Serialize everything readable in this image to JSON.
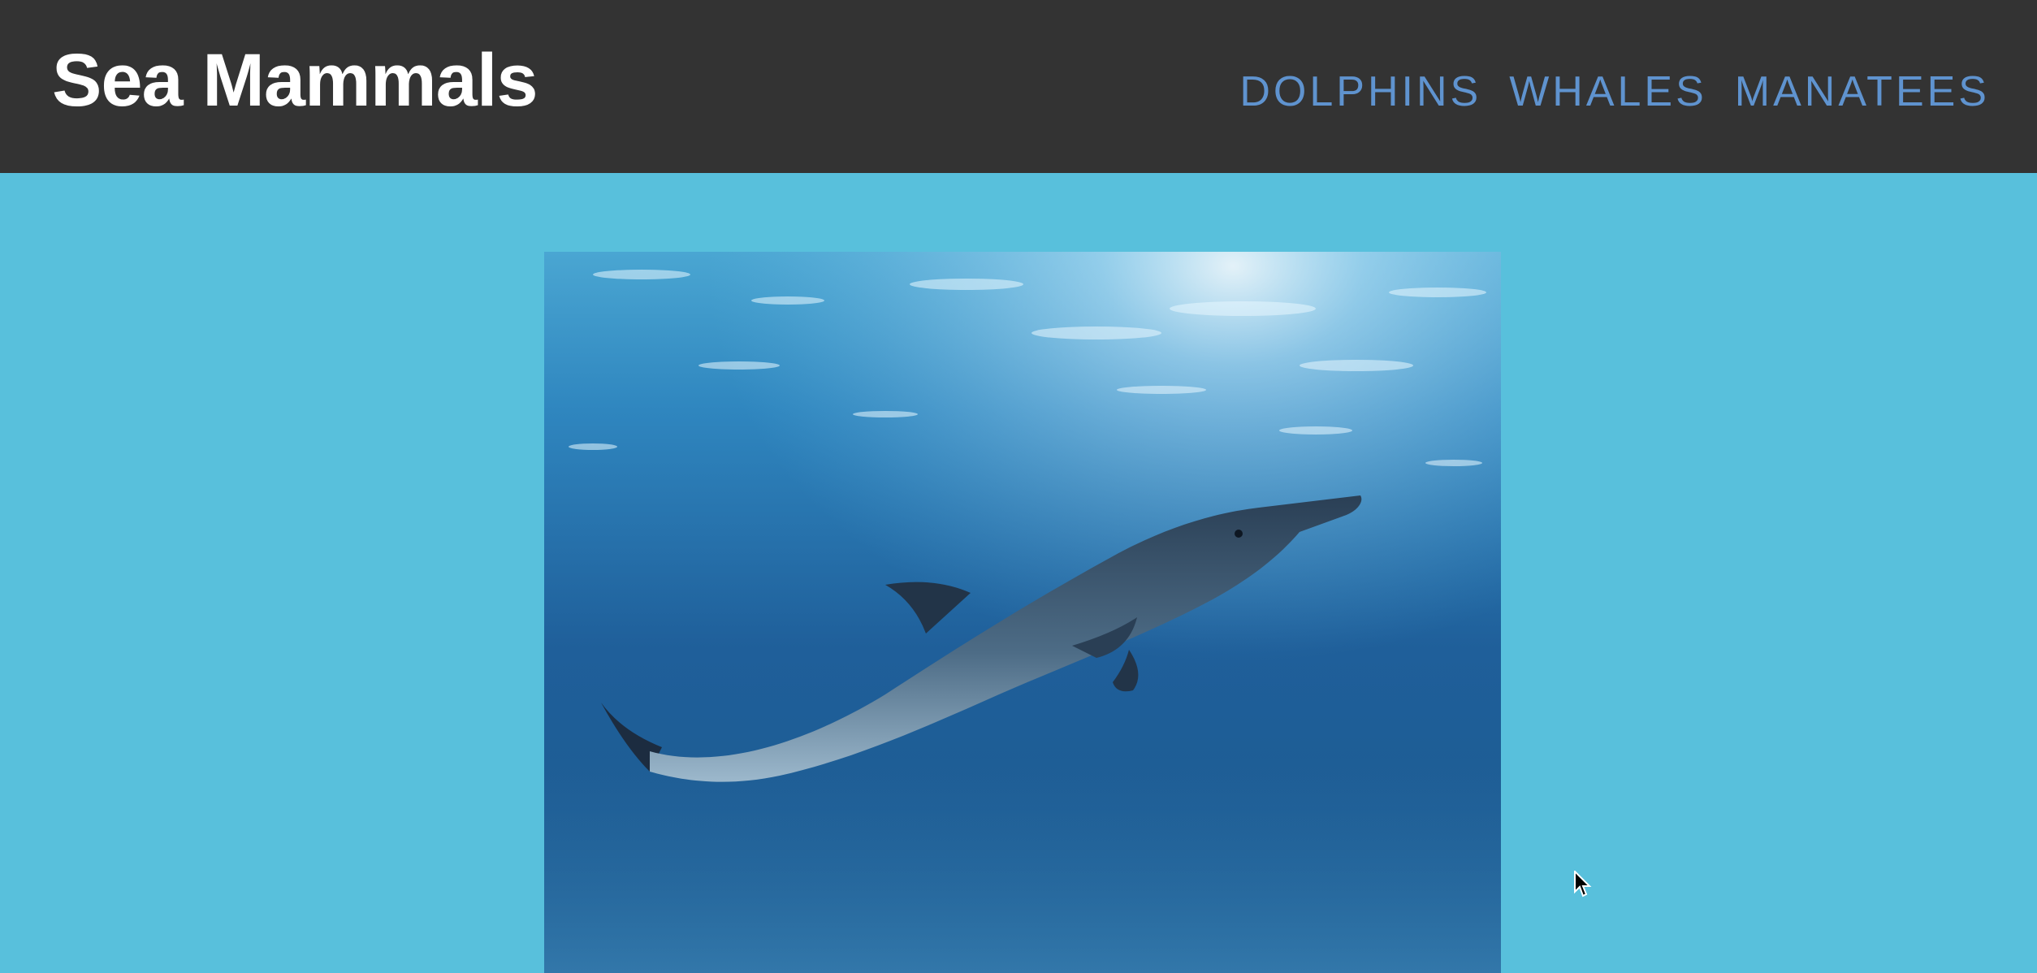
{
  "header": {
    "title": "Sea Mammals",
    "nav": [
      {
        "label": "DOLPHINS"
      },
      {
        "label": "WHALES"
      },
      {
        "label": "MANATEES"
      }
    ]
  },
  "main": {
    "image": {
      "subject": "dolphin-underwater"
    }
  },
  "colors": {
    "header_bg": "#333333",
    "page_bg": "#58c0dc",
    "nav_link": "#5f93cf",
    "title": "#ffffff"
  }
}
